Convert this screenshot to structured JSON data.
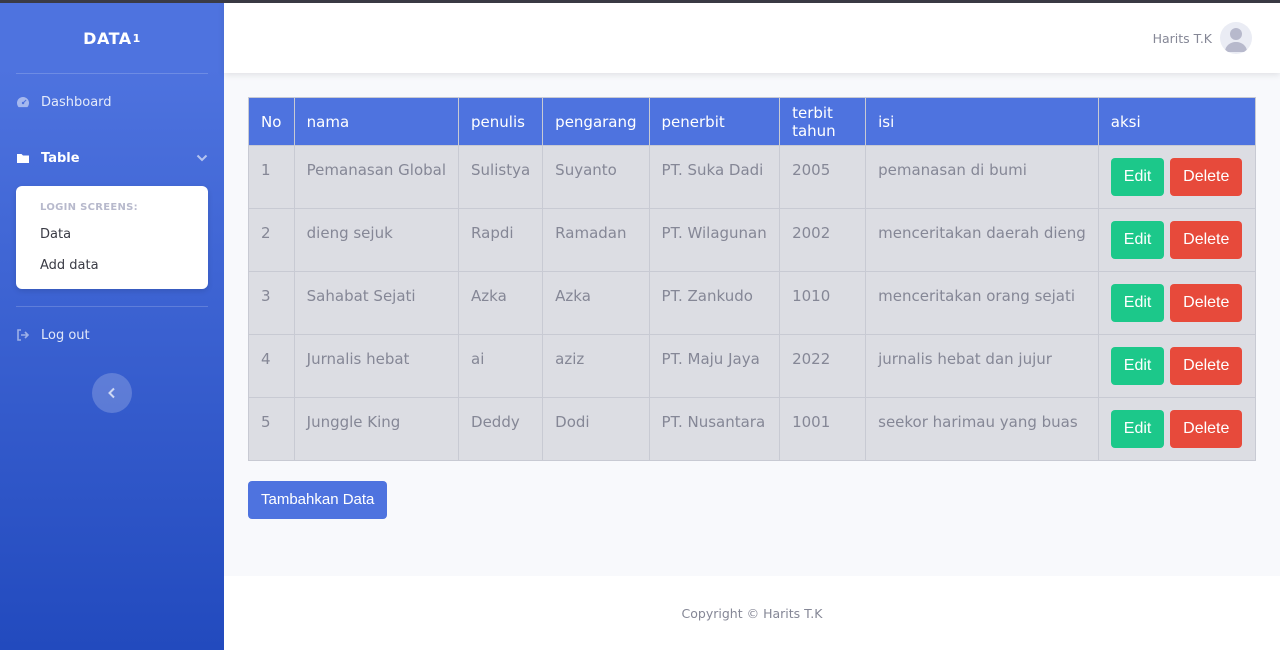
{
  "brand": {
    "name": "DATA",
    "sup": "1"
  },
  "sidebar": {
    "dashboard": "Dashboard",
    "table": "Table",
    "submenu_header": "LOGIN SCREENS:",
    "submenu_items": [
      "Data",
      "Add data"
    ],
    "logout": "Log out"
  },
  "topbar": {
    "user_name": "Harits T.K"
  },
  "table": {
    "headers": [
      "No",
      "nama",
      "penulis",
      "pengarang",
      "penerbit",
      "terbit tahun",
      "isi",
      "aksi"
    ],
    "rows": [
      [
        "1",
        "Pemanasan Global",
        "Sulistya",
        "Suyanto",
        "PT. Suka Dadi",
        "2005",
        "pemanasan di bumi"
      ],
      [
        "2",
        "dieng sejuk",
        "Rapdi",
        "Ramadan",
        "PT. Wilagunan",
        "2002",
        "menceritakan daerah dieng"
      ],
      [
        "3",
        "Sahabat Sejati",
        "Azka",
        "Azka",
        "PT. Zankudo",
        "1010",
        "menceritakan orang sejati"
      ],
      [
        "4",
        "Jurnalis hebat",
        "ai",
        "aziz",
        "PT. Maju Jaya",
        "2022",
        "jurnalis hebat dan jujur"
      ],
      [
        "5",
        "Junggle King",
        "Deddy",
        "Dodi",
        "PT. Nusantara",
        "1001",
        "seekor harimau yang buas"
      ]
    ],
    "edit_label": "Edit",
    "delete_label": "Delete"
  },
  "add_button": "Tambahkan Data",
  "footer": "Copyright © Harits T.K",
  "colors": {
    "primary": "#4e73df",
    "success": "#1cc88a",
    "danger": "#e74a3b"
  }
}
